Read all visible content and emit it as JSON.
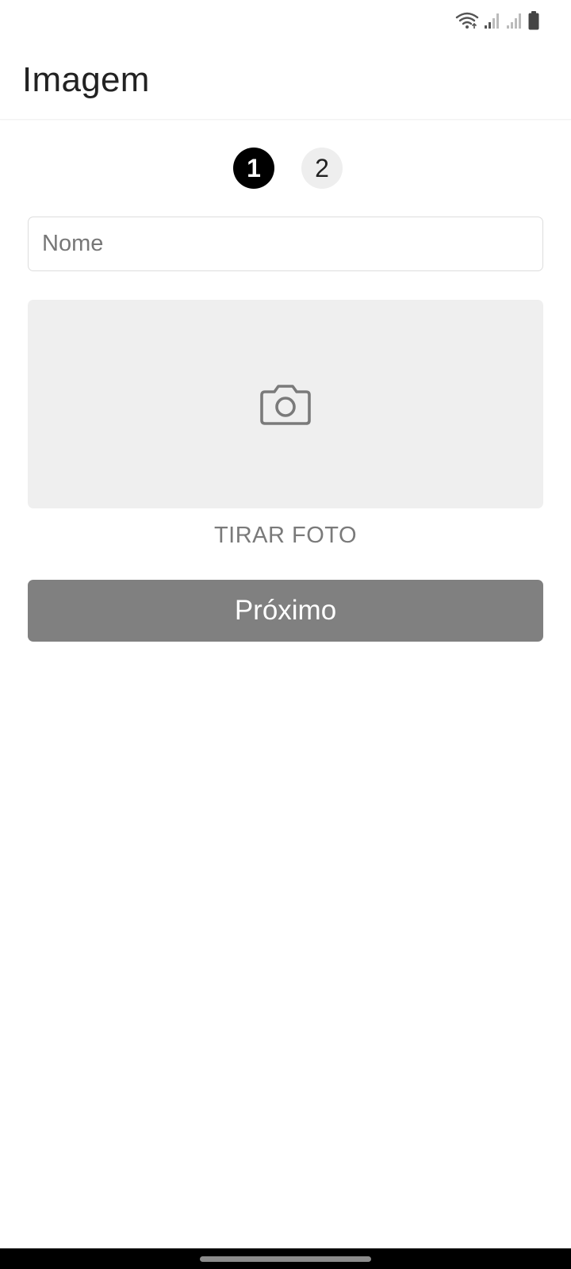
{
  "status_bar": {
    "icons": [
      "wifi-icon",
      "signal-icon",
      "signal-icon",
      "battery-icon"
    ]
  },
  "app_bar": {
    "title": "Imagem"
  },
  "stepper": {
    "steps": [
      {
        "label": "1",
        "state": "active"
      },
      {
        "label": "2",
        "state": "inactive"
      }
    ]
  },
  "form": {
    "name_placeholder": "Nome",
    "name_value": "",
    "photo_icon": "camera-icon",
    "take_photo_label": "TIRAR FOTO",
    "next_label": "Próximo"
  },
  "colors": {
    "primary_disabled": "#808080",
    "step_active": "#000000",
    "step_inactive": "#eeeeee",
    "photo_placeholder": "#efefef"
  }
}
